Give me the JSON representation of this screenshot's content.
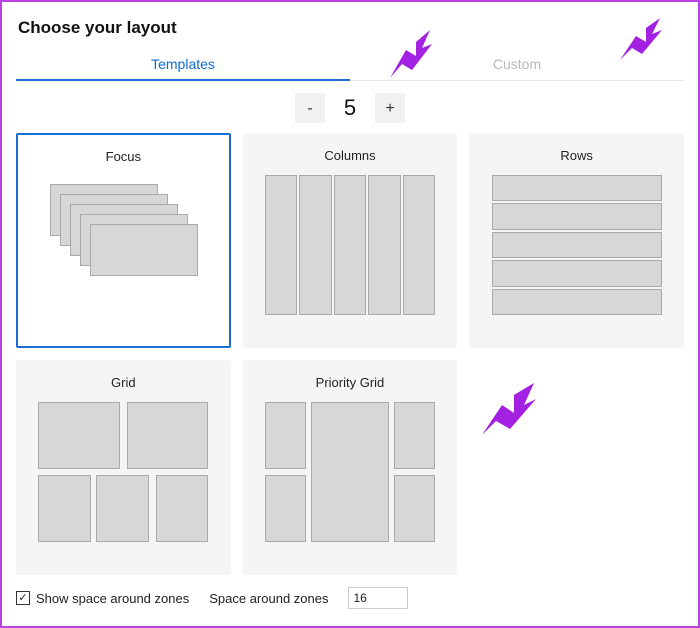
{
  "title": "Choose your layout",
  "tabs": {
    "templates": "Templates",
    "custom": "Custom"
  },
  "stepper": {
    "minus": "-",
    "value": "5",
    "plus": "+"
  },
  "cards": {
    "focus": "Focus",
    "columns": "Columns",
    "rows": "Rows",
    "grid": "Grid",
    "priority": "Priority Grid"
  },
  "footer": {
    "show_space_label": "Show space around zones",
    "space_label": "Space around zones",
    "space_value": "16",
    "checked": true
  },
  "colors": {
    "accent": "#1a6fd6",
    "arrow": "#a321e0"
  }
}
